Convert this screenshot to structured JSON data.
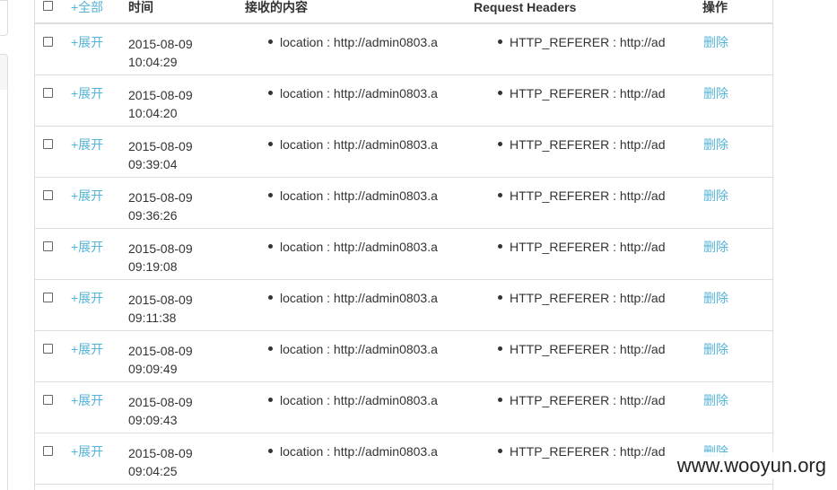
{
  "header": {
    "select_all_label": "+全部",
    "time": "时间",
    "received_content": "接收的内容",
    "request_headers": "Request Headers",
    "actions": "操作"
  },
  "rows": [
    {
      "expand": "+展开",
      "date": "2015-08-09",
      "time": "10:04:29",
      "content": "location : http://admin0803.a",
      "headers": "HTTP_REFERER : http://ad",
      "delete": "删除"
    },
    {
      "expand": "+展开",
      "date": "2015-08-09",
      "time": "10:04:20",
      "content": "location : http://admin0803.a",
      "headers": "HTTP_REFERER : http://ad",
      "delete": "删除"
    },
    {
      "expand": "+展开",
      "date": "2015-08-09",
      "time": "09:39:04",
      "content": "location : http://admin0803.a",
      "headers": "HTTP_REFERER : http://ad",
      "delete": "删除"
    },
    {
      "expand": "+展开",
      "date": "2015-08-09",
      "time": "09:36:26",
      "content": "location : http://admin0803.a",
      "headers": "HTTP_REFERER : http://ad",
      "delete": "删除"
    },
    {
      "expand": "+展开",
      "date": "2015-08-09",
      "time": "09:19:08",
      "content": "location : http://admin0803.a",
      "headers": "HTTP_REFERER : http://ad",
      "delete": "删除"
    },
    {
      "expand": "+展开",
      "date": "2015-08-09",
      "time": "09:11:38",
      "content": "location : http://admin0803.a",
      "headers": "HTTP_REFERER : http://ad",
      "delete": "删除"
    },
    {
      "expand": "+展开",
      "date": "2015-08-09",
      "time": "09:09:49",
      "content": "location : http://admin0803.a",
      "headers": "HTTP_REFERER : http://ad",
      "delete": "删除"
    },
    {
      "expand": "+展开",
      "date": "2015-08-09",
      "time": "09:09:43",
      "content": "location : http://admin0803.a",
      "headers": "HTTP_REFERER : http://ad",
      "delete": "删除"
    },
    {
      "expand": "+展开",
      "date": "2015-08-09",
      "time": "09:04:25",
      "content": "location : http://admin0803.a",
      "headers": "HTTP_REFERER : http://ad",
      "delete": "删除"
    }
  ],
  "watermark": "www.wooyun.org",
  "colors": {
    "link": "#54b4d8",
    "border": "#dddddd",
    "text": "#333333"
  }
}
